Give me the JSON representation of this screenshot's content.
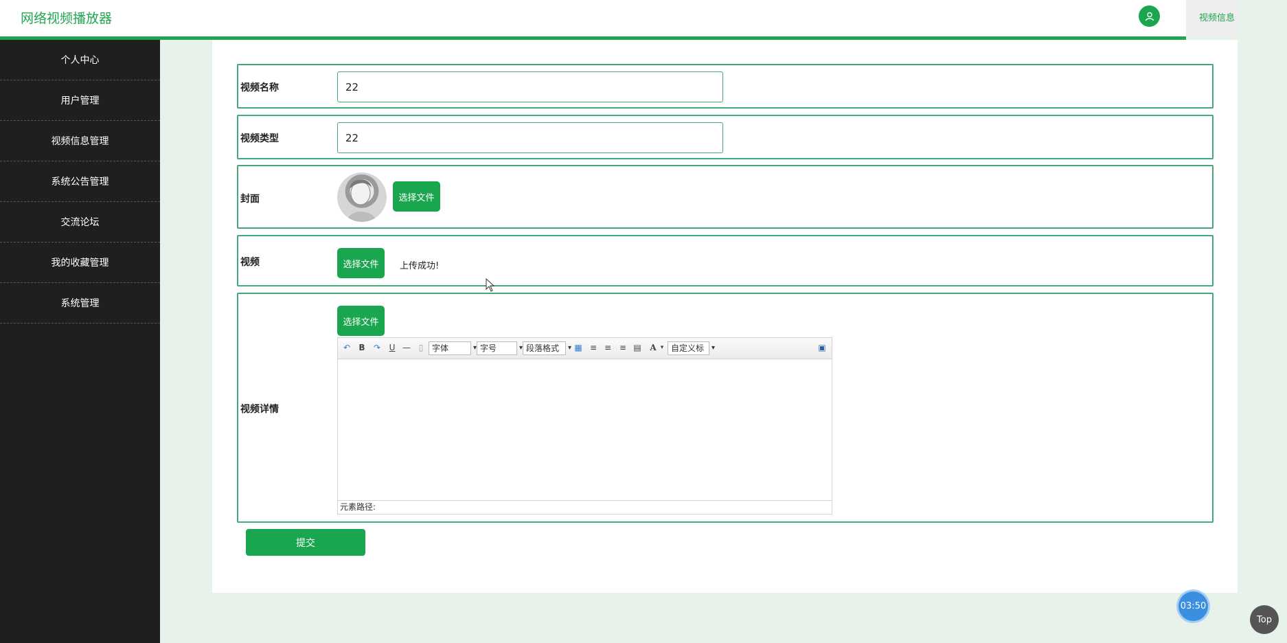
{
  "header": {
    "title": "网络视频播放器",
    "tab_label": "视频信息",
    "user_icon": "user-icon"
  },
  "sidebar": {
    "items": [
      {
        "label": "个人中心"
      },
      {
        "label": "用户管理"
      },
      {
        "label": "视频信息管理"
      },
      {
        "label": "系统公告管理"
      },
      {
        "label": "交流论坛"
      },
      {
        "label": "我的收藏管理"
      },
      {
        "label": "系统管理"
      }
    ]
  },
  "form": {
    "name": {
      "label": "视频名称",
      "value": "22"
    },
    "type": {
      "label": "视频类型",
      "value": "22"
    },
    "cover": {
      "label": "封面",
      "button": "选择文件"
    },
    "video": {
      "label": "视频",
      "button": "选择文件",
      "status": "上传成功!"
    },
    "detail": {
      "label": "视频详情",
      "button": "选择文件",
      "toolbar": {
        "font": "字体",
        "size": "字号",
        "paragraph": "段落格式",
        "custom_title": "自定义标"
      },
      "status_path": "元素路径:"
    },
    "submit": "提交"
  },
  "floating": {
    "timer": "03:50",
    "top": "Top"
  },
  "colors": {
    "accent": "#1aa64f",
    "sidebar_bg": "#1f1f1f",
    "page_bg": "#e6f2ea",
    "row_border": "#45a878"
  }
}
